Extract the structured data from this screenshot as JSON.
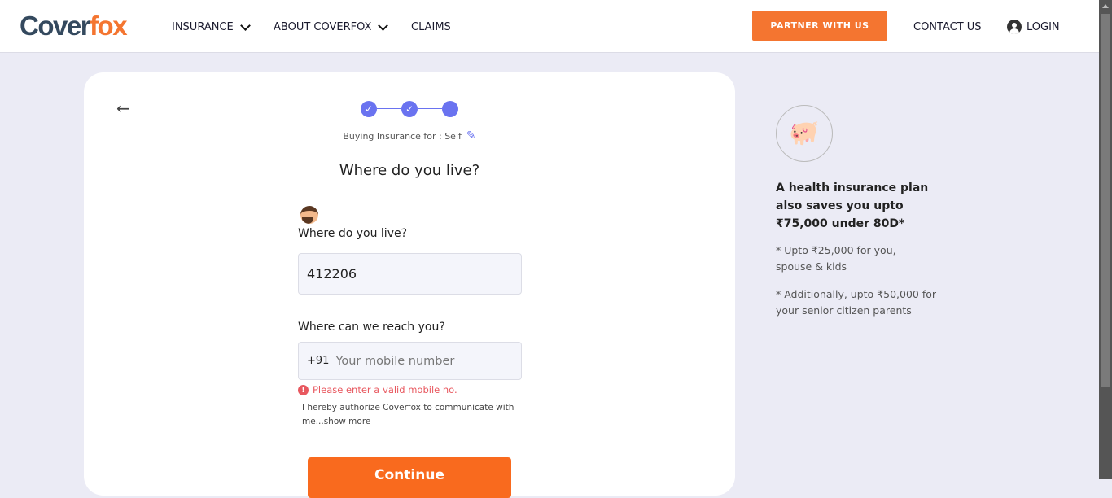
{
  "header": {
    "logo": {
      "part1": "Cover",
      "part2": "fox"
    },
    "nav": [
      {
        "label": "INSURANCE"
      },
      {
        "label": "ABOUT COVERFOX"
      },
      {
        "label": "CLAIMS"
      }
    ],
    "partner_label": "PARTNER WITH US",
    "contact_label": "CONTACT US",
    "login_label": "LOGIN"
  },
  "form": {
    "steps": [
      {
        "state": "done",
        "icon": "check-icon"
      },
      {
        "state": "done",
        "icon": "check-icon"
      },
      {
        "state": "current"
      }
    ],
    "buying_for": "Buying Insurance for : Self",
    "title": "Where do you live?",
    "location_label": "Where do you live?",
    "pincode_value": "412206",
    "mobile_label": "Where can we reach you?",
    "country_code": "+91",
    "mobile_placeholder": "Your mobile number",
    "error": "Please enter a valid mobile no.",
    "authorize": "I hereby authorize Coverfox to communicate with me...",
    "show_more": "show more",
    "continue_label": "Continue"
  },
  "sidebar": {
    "headline": "A health insurance plan also saves you upto ₹75,000 under 80D*",
    "note1": "* Upto ₹25,000 for you, spouse & kids",
    "note2": "* Additionally, upto ₹50,000 for your senior citizen parents"
  },
  "colors": {
    "brand": "#f47530",
    "accent": "#6a73f0",
    "error": "#e8585f"
  }
}
